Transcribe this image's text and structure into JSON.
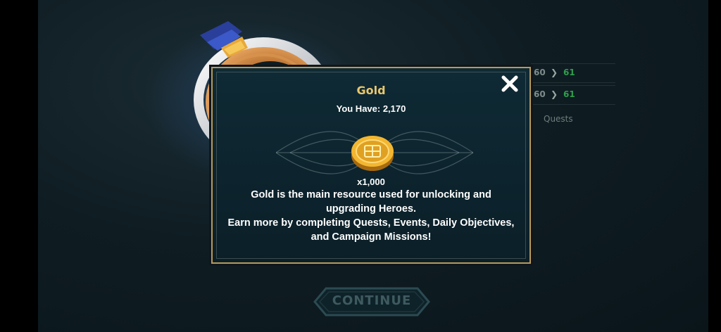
{
  "background": {
    "rows": [
      {
        "num": "60",
        "green": "61"
      },
      {
        "num": "60",
        "green": "61"
      }
    ],
    "quests_label": "Quests"
  },
  "dialog": {
    "title": "Gold",
    "you_have": "You Have: 2,170",
    "quantity": "x1,000",
    "description_line1": "Gold is the main resource used for unlocking and upgrading Heroes.",
    "description_line2": "Earn more by completing Quests, Events, Daily Objectives, and Campaign Missions!",
    "close_icon": "close-icon",
    "coin_icon": "gold-coin-icon"
  },
  "continue_label": "CONTINUE",
  "colors": {
    "title": "#e9c76e",
    "border": "#b79a5c",
    "dialog_bg": "#0f2a35",
    "continue_text": "#3e5a60"
  }
}
